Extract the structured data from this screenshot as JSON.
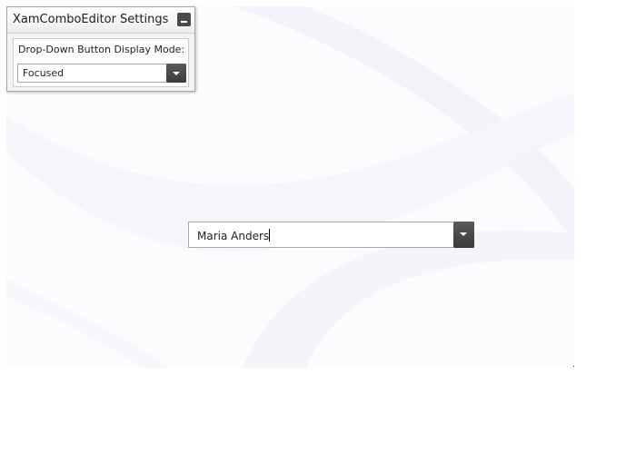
{
  "settings_panel": {
    "title": "XamComboEditor Settings",
    "mode_label": "Drop-Down Button Display Mode:",
    "mode_value": "Focused"
  },
  "combo_editor": {
    "value": "Maria Anders"
  },
  "colors": {
    "accent": "#3f3f3f",
    "panel_bg": "#f3f3f3",
    "stage_bg": "#fbfcfe"
  },
  "icons": {
    "minimize": "minimize-icon",
    "dropdown": "chevron-down-icon"
  }
}
